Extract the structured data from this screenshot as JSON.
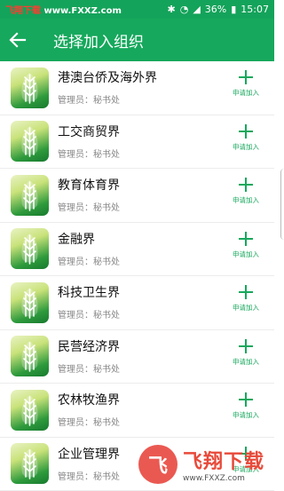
{
  "statusbar": {
    "watermark_left": "飞翔下载",
    "watermark_url": "www.FXXZ.com",
    "battery": "36%",
    "time": "15:07"
  },
  "appbar": {
    "title": "选择加入组织"
  },
  "join_label": "申请加入",
  "admin_prefix": "管理员：",
  "orgs": [
    {
      "name": "港澳台侨及海外界",
      "admin": "管理员：秘书处"
    },
    {
      "name": "工交商贸界",
      "admin": "管理员：秘书处"
    },
    {
      "name": "教育体育界",
      "admin": "管理员：秘书处"
    },
    {
      "name": "金融界",
      "admin": "管理员：秘书处"
    },
    {
      "name": "科技卫生界",
      "admin": "管理员：秘书处"
    },
    {
      "name": "民营经济界",
      "admin": "管理员：秘书处"
    },
    {
      "name": "农林牧渔界",
      "admin": "管理员：秘书处"
    },
    {
      "name": "企业管理界",
      "admin": "管理员：秘书处"
    }
  ],
  "watermark": {
    "brand": "飞翔下载",
    "url": "www.FXXZ.com"
  },
  "colors": {
    "primary": "#16a85c",
    "statusbar": "#14a35a"
  }
}
